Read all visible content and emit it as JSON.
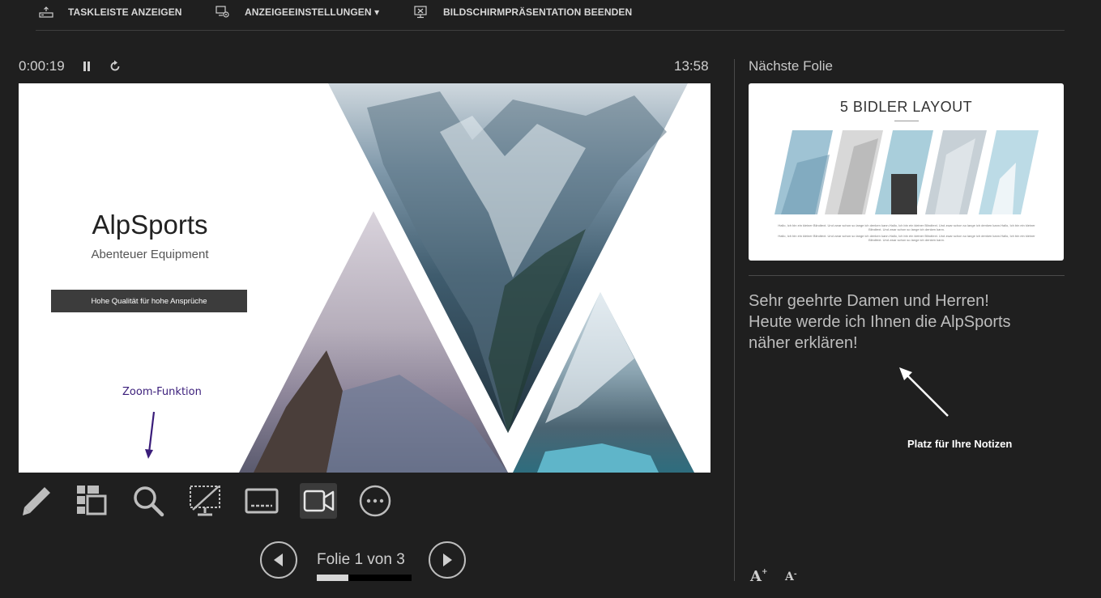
{
  "toolbar": {
    "taskbar_label": "TASKLEISTE ANZEIGEN",
    "display_settings_label": "ANZEIGEEINSTELLUNGEN ▾",
    "end_show_label": "BILDSCHIRMPRÄSENTATION BEENDEN"
  },
  "presenter": {
    "elapsed_time": "0:00:19",
    "clock": "13:58"
  },
  "current_slide": {
    "title": "AlpSports",
    "subtitle": "Abenteuer Equipment",
    "band_text": "Hohe Qualität für hohe Ansprüche",
    "annotation": "Zoom-Funktion"
  },
  "tools": [
    {
      "name": "pen-icon"
    },
    {
      "name": "all-slides-icon"
    },
    {
      "name": "zoom-icon"
    },
    {
      "name": "black-screen-icon"
    },
    {
      "name": "subtitles-icon"
    },
    {
      "name": "camera-icon",
      "active": true
    },
    {
      "name": "more-options-icon"
    }
  ],
  "navigation": {
    "counter": "Folie 1 von 3",
    "progress": 0.33
  },
  "next_slide": {
    "label": "Nächste Folie",
    "title": "5 BIDLER LAYOUT",
    "text_1": "Hallo, Ich bin ein kleiner Blindtext. Und zwar schon so lange ich denken kann.Hallo, Ich bin ein kleiner Blindtext. Und zwar schon so lange ich denken kann.Hallo, Ich bin ein kleiner Blindtext. Und zwar schon so lange ich denken kann.",
    "text_2": "Hallo, Ich bin ein kleiner Blindtext. Und zwar schon so lange ich denken kann.Hallo, Ich bin ein kleiner Blindtext. Und zwar schon so lange ich denken kann.Hallo, Ich bin ein kleiner Blindtext. Und zwar schon so lange ich denken kann."
  },
  "notes": {
    "line_1": "Sehr geehrte Damen und Herren!",
    "line_2": "Heute werde ich Ihnen die AlpSports",
    "line_3": "näher erklären!",
    "hint": "Platz für Ihre Notizen"
  },
  "font_controls": {
    "increase_label": "A",
    "decrease_label": "A"
  },
  "colors": {
    "background": "#1f1f1f",
    "annotation": "#3a1d7a"
  }
}
